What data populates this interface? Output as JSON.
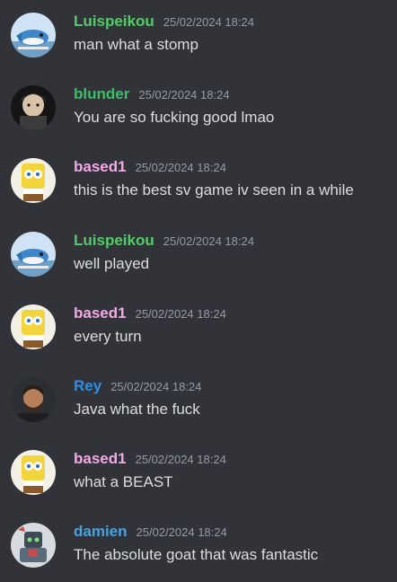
{
  "colors": {
    "background": "#313338",
    "text": "#dbdee1",
    "timestamp": "#949ba4"
  },
  "messages": [
    {
      "username": "Luispeikou",
      "name_color": "#57c96b",
      "timestamp": "25/02/2024 18:24",
      "content": "man what a stomp",
      "avatar": "fish-sleeping-avatar"
    },
    {
      "username": "blunder",
      "name_color": "#3bbf68",
      "timestamp": "25/02/2024 18:24",
      "content": "You are so fucking good lmao",
      "avatar": "dark-anime-avatar"
    },
    {
      "username": "based1",
      "name_color": "#f5a8e6",
      "timestamp": "25/02/2024 18:24",
      "content": "this is the best sv game iv seen in a while",
      "avatar": "spongebob-avatar"
    },
    {
      "username": "Luispeikou",
      "name_color": "#57c96b",
      "timestamp": "25/02/2024 18:24",
      "content": "well played",
      "avatar": "fish-sleeping-avatar"
    },
    {
      "username": "based1",
      "name_color": "#f5a8e6",
      "timestamp": "25/02/2024 18:24",
      "content": "every turn",
      "avatar": "spongebob-avatar"
    },
    {
      "username": "Rey",
      "name_color": "#2f8fe6",
      "timestamp": "25/02/2024 18:24",
      "content": "Java what the fuck",
      "avatar": "man-portrait-avatar"
    },
    {
      "username": "based1",
      "name_color": "#f5a8e6",
      "timestamp": "25/02/2024 18:24",
      "content": "what a BEAST",
      "avatar": "spongebob-avatar"
    },
    {
      "username": "damien",
      "name_color": "#4aa3dd",
      "timestamp": "25/02/2024 18:24",
      "content": "The absolute goat that was fantastic",
      "avatar": "robot-avatar"
    }
  ]
}
